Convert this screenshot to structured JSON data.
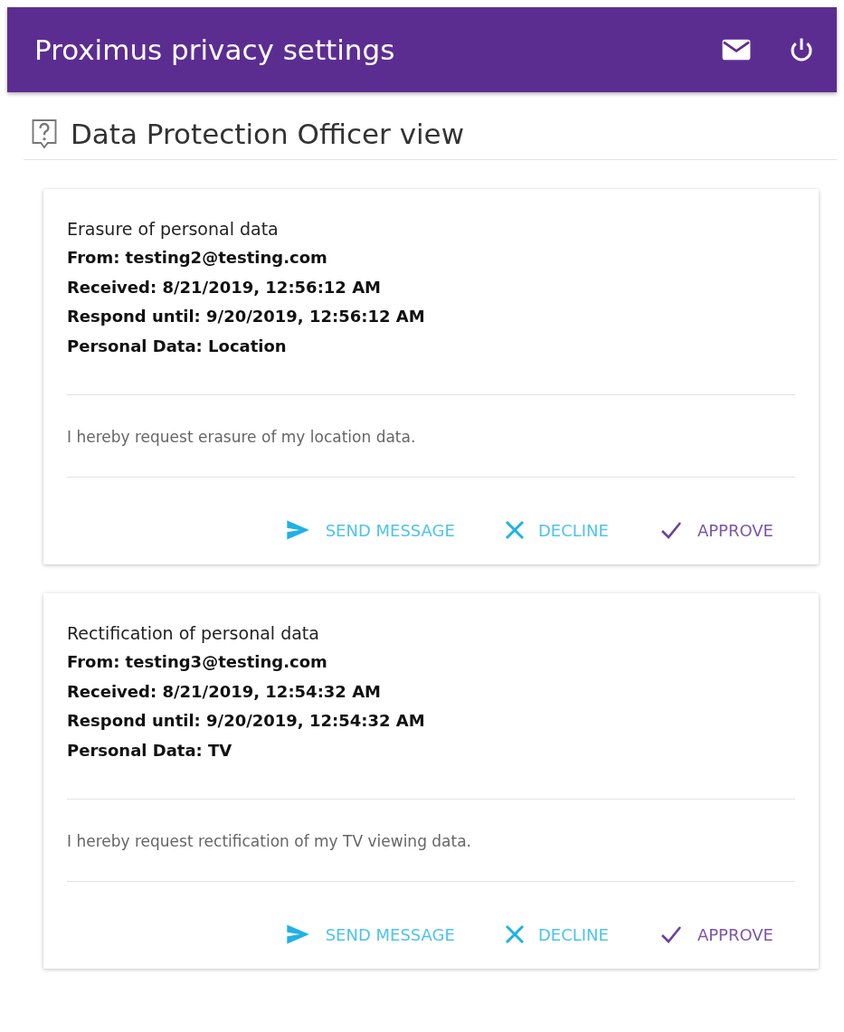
{
  "header": {
    "title": "Proximus privacy settings"
  },
  "page": {
    "title": "Data Protection Officer view"
  },
  "requests": [
    {
      "title": "Erasure of personal data",
      "details": [
        "From: testing2@testing.com",
        "Received: 8/21/2019, 12:56:12 AM",
        "Respond until: 9/20/2019, 12:56:12 AM",
        "Personal Data: Location"
      ],
      "message": "I hereby request erasure of my location data.",
      "actions": [
        {
          "kind": "send",
          "label": "SEND MESSAGE"
        },
        {
          "kind": "decline",
          "label": "DECLINE"
        },
        {
          "kind": "approve",
          "label": "APPROVE"
        }
      ]
    },
    {
      "title": "Rectification of personal data",
      "details": [
        "From: testing3@testing.com",
        "Received: 8/21/2019, 12:54:32 AM",
        "Respond until: 9/20/2019, 12:54:32 AM",
        "Personal Data: TV"
      ],
      "message": "I hereby request rectification of my TV viewing data.",
      "actions": [
        {
          "kind": "send",
          "label": "SEND MESSAGE"
        },
        {
          "kind": "decline",
          "label": "DECLINE"
        },
        {
          "kind": "approve",
          "label": "APPROVE"
        }
      ]
    }
  ]
}
